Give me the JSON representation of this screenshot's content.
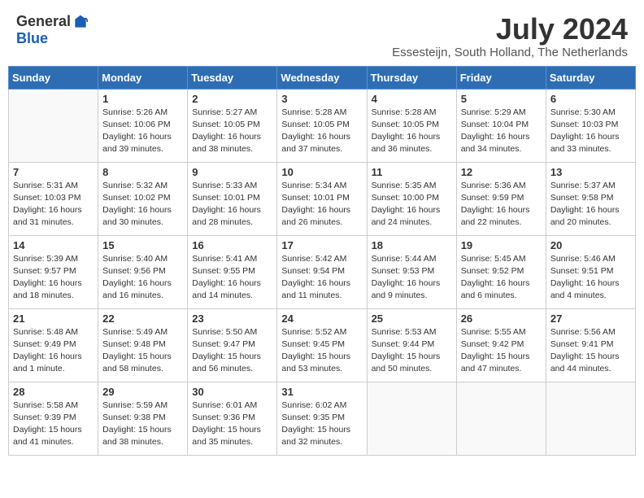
{
  "header": {
    "logo_general": "General",
    "logo_blue": "Blue",
    "month_year": "July 2024",
    "location": "Essesteijn, South Holland, The Netherlands"
  },
  "weekdays": [
    "Sunday",
    "Monday",
    "Tuesday",
    "Wednesday",
    "Thursday",
    "Friday",
    "Saturday"
  ],
  "weeks": [
    [
      {
        "day": "",
        "sunrise": "",
        "sunset": "",
        "daylight": ""
      },
      {
        "day": "1",
        "sunrise": "Sunrise: 5:26 AM",
        "sunset": "Sunset: 10:06 PM",
        "daylight": "Daylight: 16 hours and 39 minutes."
      },
      {
        "day": "2",
        "sunrise": "Sunrise: 5:27 AM",
        "sunset": "Sunset: 10:05 PM",
        "daylight": "Daylight: 16 hours and 38 minutes."
      },
      {
        "day": "3",
        "sunrise": "Sunrise: 5:28 AM",
        "sunset": "Sunset: 10:05 PM",
        "daylight": "Daylight: 16 hours and 37 minutes."
      },
      {
        "day": "4",
        "sunrise": "Sunrise: 5:28 AM",
        "sunset": "Sunset: 10:05 PM",
        "daylight": "Daylight: 16 hours and 36 minutes."
      },
      {
        "day": "5",
        "sunrise": "Sunrise: 5:29 AM",
        "sunset": "Sunset: 10:04 PM",
        "daylight": "Daylight: 16 hours and 34 minutes."
      },
      {
        "day": "6",
        "sunrise": "Sunrise: 5:30 AM",
        "sunset": "Sunset: 10:03 PM",
        "daylight": "Daylight: 16 hours and 33 minutes."
      }
    ],
    [
      {
        "day": "7",
        "sunrise": "Sunrise: 5:31 AM",
        "sunset": "Sunset: 10:03 PM",
        "daylight": "Daylight: 16 hours and 31 minutes."
      },
      {
        "day": "8",
        "sunrise": "Sunrise: 5:32 AM",
        "sunset": "Sunset: 10:02 PM",
        "daylight": "Daylight: 16 hours and 30 minutes."
      },
      {
        "day": "9",
        "sunrise": "Sunrise: 5:33 AM",
        "sunset": "Sunset: 10:01 PM",
        "daylight": "Daylight: 16 hours and 28 minutes."
      },
      {
        "day": "10",
        "sunrise": "Sunrise: 5:34 AM",
        "sunset": "Sunset: 10:01 PM",
        "daylight": "Daylight: 16 hours and 26 minutes."
      },
      {
        "day": "11",
        "sunrise": "Sunrise: 5:35 AM",
        "sunset": "Sunset: 10:00 PM",
        "daylight": "Daylight: 16 hours and 24 minutes."
      },
      {
        "day": "12",
        "sunrise": "Sunrise: 5:36 AM",
        "sunset": "Sunset: 9:59 PM",
        "daylight": "Daylight: 16 hours and 22 minutes."
      },
      {
        "day": "13",
        "sunrise": "Sunrise: 5:37 AM",
        "sunset": "Sunset: 9:58 PM",
        "daylight": "Daylight: 16 hours and 20 minutes."
      }
    ],
    [
      {
        "day": "14",
        "sunrise": "Sunrise: 5:39 AM",
        "sunset": "Sunset: 9:57 PM",
        "daylight": "Daylight: 16 hours and 18 minutes."
      },
      {
        "day": "15",
        "sunrise": "Sunrise: 5:40 AM",
        "sunset": "Sunset: 9:56 PM",
        "daylight": "Daylight: 16 hours and 16 minutes."
      },
      {
        "day": "16",
        "sunrise": "Sunrise: 5:41 AM",
        "sunset": "Sunset: 9:55 PM",
        "daylight": "Daylight: 16 hours and 14 minutes."
      },
      {
        "day": "17",
        "sunrise": "Sunrise: 5:42 AM",
        "sunset": "Sunset: 9:54 PM",
        "daylight": "Daylight: 16 hours and 11 minutes."
      },
      {
        "day": "18",
        "sunrise": "Sunrise: 5:44 AM",
        "sunset": "Sunset: 9:53 PM",
        "daylight": "Daylight: 16 hours and 9 minutes."
      },
      {
        "day": "19",
        "sunrise": "Sunrise: 5:45 AM",
        "sunset": "Sunset: 9:52 PM",
        "daylight": "Daylight: 16 hours and 6 minutes."
      },
      {
        "day": "20",
        "sunrise": "Sunrise: 5:46 AM",
        "sunset": "Sunset: 9:51 PM",
        "daylight": "Daylight: 16 hours and 4 minutes."
      }
    ],
    [
      {
        "day": "21",
        "sunrise": "Sunrise: 5:48 AM",
        "sunset": "Sunset: 9:49 PM",
        "daylight": "Daylight: 16 hours and 1 minute."
      },
      {
        "day": "22",
        "sunrise": "Sunrise: 5:49 AM",
        "sunset": "Sunset: 9:48 PM",
        "daylight": "Daylight: 15 hours and 58 minutes."
      },
      {
        "day": "23",
        "sunrise": "Sunrise: 5:50 AM",
        "sunset": "Sunset: 9:47 PM",
        "daylight": "Daylight: 15 hours and 56 minutes."
      },
      {
        "day": "24",
        "sunrise": "Sunrise: 5:52 AM",
        "sunset": "Sunset: 9:45 PM",
        "daylight": "Daylight: 15 hours and 53 minutes."
      },
      {
        "day": "25",
        "sunrise": "Sunrise: 5:53 AM",
        "sunset": "Sunset: 9:44 PM",
        "daylight": "Daylight: 15 hours and 50 minutes."
      },
      {
        "day": "26",
        "sunrise": "Sunrise: 5:55 AM",
        "sunset": "Sunset: 9:42 PM",
        "daylight": "Daylight: 15 hours and 47 minutes."
      },
      {
        "day": "27",
        "sunrise": "Sunrise: 5:56 AM",
        "sunset": "Sunset: 9:41 PM",
        "daylight": "Daylight: 15 hours and 44 minutes."
      }
    ],
    [
      {
        "day": "28",
        "sunrise": "Sunrise: 5:58 AM",
        "sunset": "Sunset: 9:39 PM",
        "daylight": "Daylight: 15 hours and 41 minutes."
      },
      {
        "day": "29",
        "sunrise": "Sunrise: 5:59 AM",
        "sunset": "Sunset: 9:38 PM",
        "daylight": "Daylight: 15 hours and 38 minutes."
      },
      {
        "day": "30",
        "sunrise": "Sunrise: 6:01 AM",
        "sunset": "Sunset: 9:36 PM",
        "daylight": "Daylight: 15 hours and 35 minutes."
      },
      {
        "day": "31",
        "sunrise": "Sunrise: 6:02 AM",
        "sunset": "Sunset: 9:35 PM",
        "daylight": "Daylight: 15 hours and 32 minutes."
      },
      {
        "day": "",
        "sunrise": "",
        "sunset": "",
        "daylight": ""
      },
      {
        "day": "",
        "sunrise": "",
        "sunset": "",
        "daylight": ""
      },
      {
        "day": "",
        "sunrise": "",
        "sunset": "",
        "daylight": ""
      }
    ]
  ]
}
